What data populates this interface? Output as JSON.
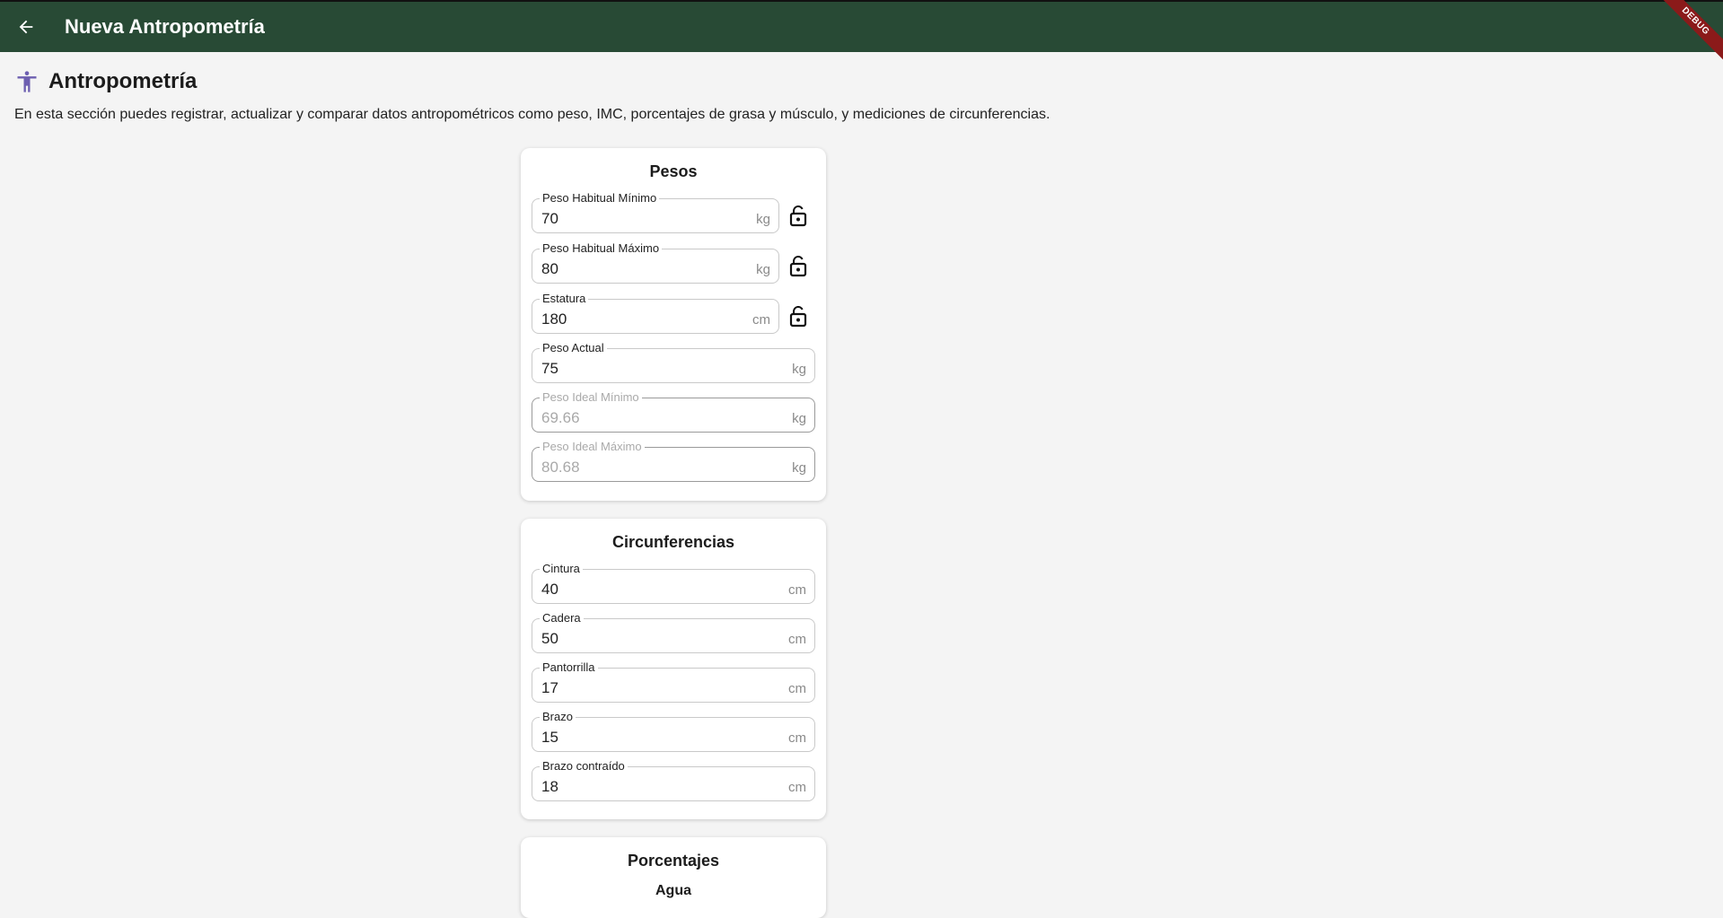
{
  "appbar": {
    "title": "Nueva Antropometría",
    "debug_label": "DEBUG"
  },
  "header": {
    "title": "Antropometría",
    "icon": "accessibility-icon",
    "description": "En esta sección puedes registrar, actualizar y comparar datos antropométricos como peso, IMC, porcentajes de grasa y músculo, y mediciones de circunferencias."
  },
  "colors": {
    "appbar": "#284a35",
    "accent_icon": "#6d5fb0",
    "debug": "#8b1a1a"
  },
  "pesos": {
    "title": "Pesos",
    "fields": [
      {
        "label": "Peso Habitual Mínimo",
        "value": "70",
        "unit": "kg",
        "locked_icon": true
      },
      {
        "label": "Peso Habitual Máximo",
        "value": "80",
        "unit": "kg",
        "locked_icon": true
      },
      {
        "label": "Estatura",
        "value": "180",
        "unit": "cm",
        "locked_icon": true
      },
      {
        "label": "Peso Actual",
        "value": "75",
        "unit": "kg"
      },
      {
        "label": "Peso Ideal Mínimo",
        "value": "69.66",
        "unit": "kg",
        "disabled": true
      },
      {
        "label": "Peso Ideal Máximo",
        "value": "80.68",
        "unit": "kg",
        "disabled": true
      }
    ]
  },
  "circunferencias": {
    "title": "Circunferencias",
    "fields": [
      {
        "label": "Cintura",
        "value": "40",
        "unit": "cm"
      },
      {
        "label": "Cadera",
        "value": "50",
        "unit": "cm"
      },
      {
        "label": "Pantorrilla",
        "value": "17",
        "unit": "cm"
      },
      {
        "label": "Brazo",
        "value": "15",
        "unit": "cm"
      },
      {
        "label": "Brazo contraído",
        "value": "18",
        "unit": "cm"
      }
    ]
  },
  "porcentajes": {
    "title": "Porcentajes",
    "subtitle": "Agua"
  }
}
